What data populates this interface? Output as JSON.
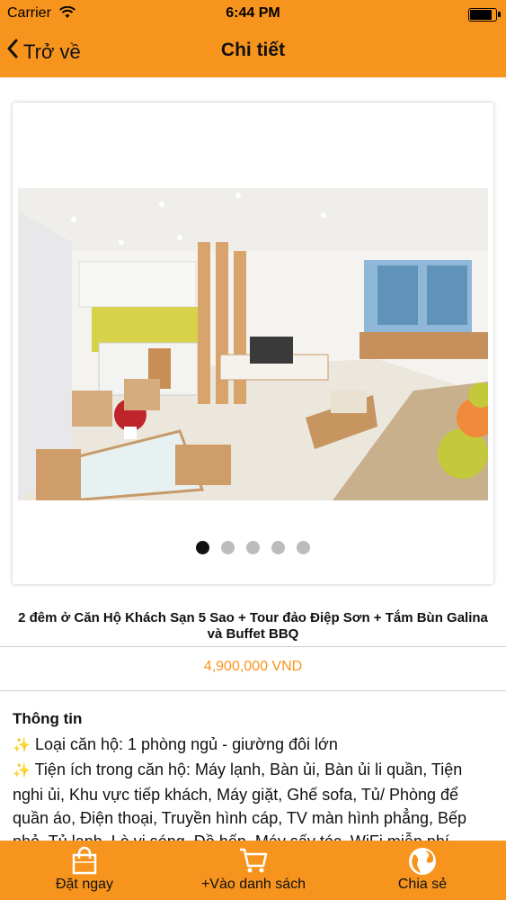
{
  "status_bar": {
    "carrier": "Carrier",
    "time": "6:44 PM"
  },
  "nav": {
    "back_label": "Trở về",
    "title": "Chi tiết"
  },
  "gallery": {
    "slide_count": 5,
    "active_index": 0
  },
  "product": {
    "title": "2 đêm ở Căn Hộ Khách Sạn 5 Sao + Tour đảo Điệp Sơn + Tắm Bùn Galina và Buffet BBQ",
    "price": "4,900,000 VND"
  },
  "info": {
    "heading": "Thông tin",
    "line1": "Loại căn hộ: 1 phòng ngủ - giường đôi lớn",
    "line2": "Tiện ích trong căn hộ: Máy lạnh, Bàn ủi, Bàn ủi li quần, Tiện nghi ủi, Khu vực tiếp khách, Máy giặt, Ghế sofa, Tủ/ Phòng để quần áo, Điện thoại, Truyền hình cáp, TV màn hình phẳng, Bếp nhỏ, Tủ lạnh, Lò vi sóng, Đồ bếp, Máy sấy tóc, WiFi miễn phí"
  },
  "tabbar": {
    "book_label": "Đặt ngay",
    "cart_label": "+Vào danh sách",
    "share_label": "Chia sẻ"
  },
  "colors": {
    "accent": "#f7941d",
    "price": "#f7941d"
  }
}
